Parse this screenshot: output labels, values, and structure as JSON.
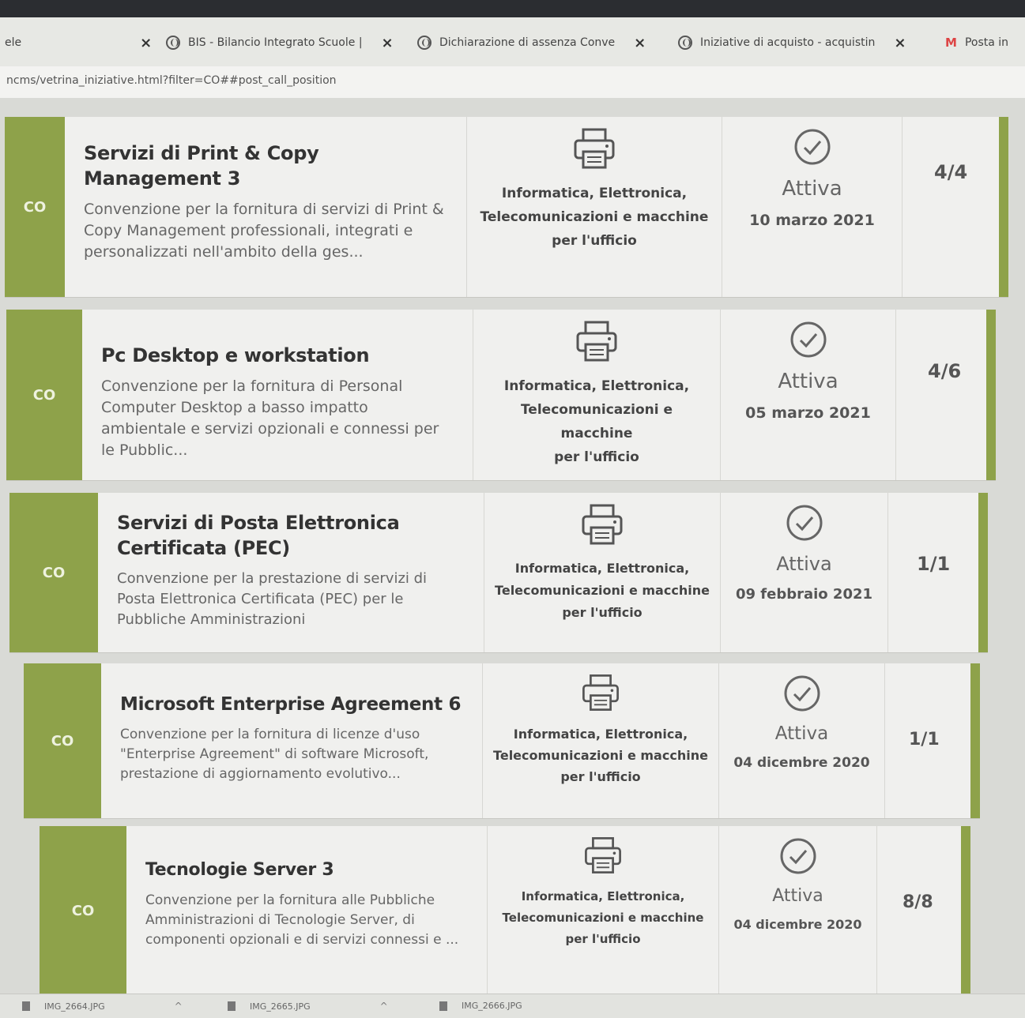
{
  "browser": {
    "tabs": [
      {
        "label": "ele",
        "has_globe": false
      },
      {
        "label": "BIS - Bilancio Integrato Scuole |",
        "has_globe": true
      },
      {
        "label": "Dichiarazione di assenza Conve",
        "has_globe": true
      },
      {
        "label": "Iniziative di acquisto - acquistin",
        "has_globe": true
      },
      {
        "label": "Posta in",
        "has_globe": false
      }
    ],
    "tab_close_glyph": "×",
    "url": "ncms/vetrina_iniziative.html?filter=CO##post_call_position"
  },
  "rows": [
    {
      "badge": "CO",
      "title": "Servizi di Print & Copy Management 3",
      "description": "Convenzione per la fornitura di servizi di Print & Copy Management professionali, integrati e personalizzati nell'ambito della ges...",
      "category_lines": [
        "Informatica, Elettronica,",
        "Telecomunicazioni e macchine",
        "per l'ufficio"
      ],
      "status": "Attiva",
      "date": "10 marzo 2021",
      "count": "4/4"
    },
    {
      "badge": "CO",
      "title": "Pc Desktop e workstation",
      "description": "Convenzione per la fornitura di Personal Computer Desktop a basso impatto ambientale e servizi opzionali e connessi per le Pubblic...",
      "category_lines": [
        "Informatica, Elettronica,",
        "Telecomunicazioni e macchine",
        "per l'ufficio"
      ],
      "status": "Attiva",
      "date": "05 marzo 2021",
      "count": "4/6"
    },
    {
      "badge": "CO",
      "title": "Servizi di Posta Elettronica Certificata (PEC)",
      "description": "Convenzione per la prestazione di servizi di Posta Elettronica Certificata (PEC) per le Pubbliche Amministrazioni",
      "category_lines": [
        "Informatica, Elettronica,",
        "Telecomunicazioni e macchine",
        "per l'ufficio"
      ],
      "status": "Attiva",
      "date": "09 febbraio 2021",
      "count": "1/1"
    },
    {
      "badge": "CO",
      "title": "Microsoft Enterprise Agreement 6",
      "description": "Convenzione per la fornitura di licenze d'uso \"Enterprise Agreement\" di software Microsoft, prestazione di aggiornamento evolutivo...",
      "category_lines": [
        "Informatica, Elettronica,",
        "Telecomunicazioni e macchine",
        "per l'ufficio"
      ],
      "status": "Attiva",
      "date": "04 dicembre 2020",
      "count": "1/1"
    },
    {
      "badge": "CO",
      "title": "Tecnologie Server 3",
      "description": "Convenzione per la fornitura alle Pubbliche Amministrazioni di Tecnologie Server, di componenti opzionali e di servizi connessi e ...",
      "category_lines": [
        "Informatica, Elettronica,",
        "Telecomunicazioni e macchine",
        "per l'ufficio"
      ],
      "status": "Attiva",
      "date": "04 dicembre 2020",
      "count": "8/8"
    }
  ],
  "downloads": [
    {
      "name": "IMG_2664.JPG"
    },
    {
      "name": "IMG_2665.JPG"
    },
    {
      "name": "IMG_2666.JPG"
    }
  ],
  "colors": {
    "accent_green": "#8ea24a",
    "row_bg": "#f0f0ee"
  }
}
